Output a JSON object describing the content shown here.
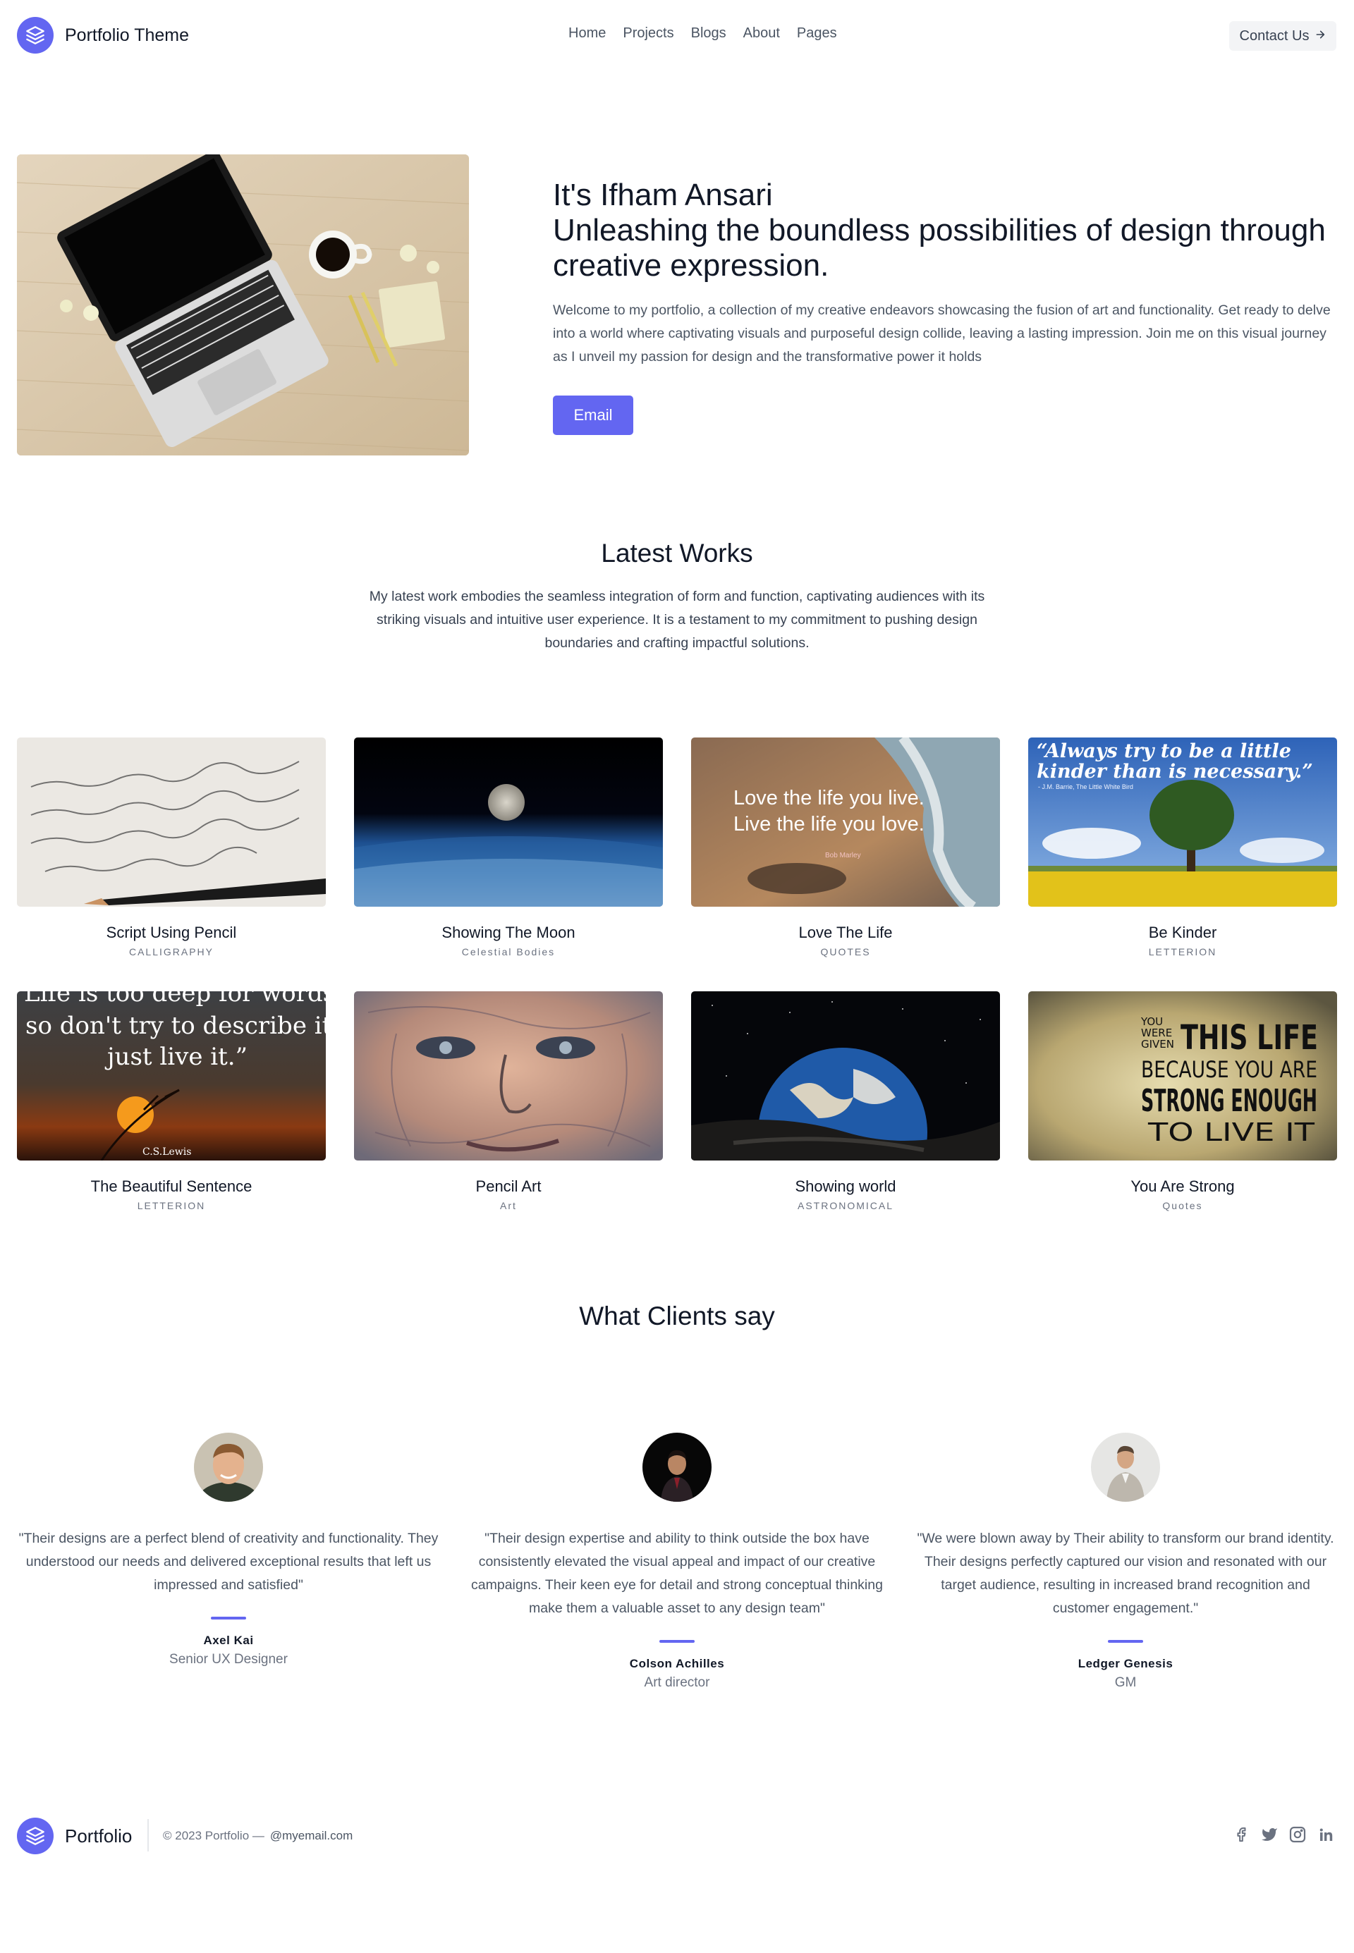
{
  "header": {
    "brand": "Portfolio Theme",
    "nav": [
      "Home",
      "Projects",
      "Blogs",
      "About",
      "Pages"
    ],
    "contact_label": "Contact Us"
  },
  "hero": {
    "greeting": "It's Ifham Ansari",
    "headline": "Unleashing the boundless possibilities of design through creative expression.",
    "description": "Welcome to my portfolio, a collection of my creative endeavors showcasing the fusion of art and functionality. Get ready to delve into a world where captivating visuals and purposeful design collide, leaving a lasting impression. Join me on this visual journey as I unveil my passion for design and the transformative power it holds",
    "button": "Email"
  },
  "works": {
    "title": "Latest Works",
    "description": "My latest work embodies the seamless integration of form and function, captivating audiences with its striking visuals and intuitive user experience. It is a testament to my commitment to pushing design boundaries and crafting impactful solutions.",
    "items": [
      {
        "title": "Script Using Pencil",
        "category": "CALLIGRAPHY"
      },
      {
        "title": "Showing The Moon",
        "category": "Celestial Bodies"
      },
      {
        "title": "Love The Life",
        "category": "QUOTES",
        "image_text": [
          "Love the life you live.",
          "Live the life you love.",
          "Bob Marley"
        ]
      },
      {
        "title": "Be Kinder",
        "category": "LETTERION",
        "image_text": [
          "“Always try to be a little",
          "kinder than is necessary.”",
          "- J.M. Barrie, The Little White Bird"
        ]
      },
      {
        "title": "The Beautiful Sentence",
        "category": "LETTERION",
        "image_text": [
          "Life is too deep for words,",
          "so don't try to describe it,",
          "just live it.”",
          "C.S.Lewis"
        ]
      },
      {
        "title": "Pencil Art",
        "category": "Art"
      },
      {
        "title": "Showing world",
        "category": "ASTRONOMICAL"
      },
      {
        "title": "You Are Strong",
        "category": "Quotes",
        "image_text": [
          "YOU",
          "WERE",
          "GIVEN",
          "THIS LIFE",
          "BECAUSE YOU ARE",
          "STRONG ENOUGH",
          "TO LIVE IT"
        ]
      }
    ]
  },
  "clients": {
    "title": "What Clients say",
    "items": [
      {
        "quote": "\"Their designs are a perfect blend of creativity and functionality. They understood our needs and delivered exceptional results that left us impressed and satisfied\"",
        "name": "Axel Kai",
        "role": "Senior UX Designer"
      },
      {
        "quote": "\"Their design expertise and ability to think outside the box have consistently elevated the visual appeal and impact of our creative campaigns. Their keen eye for detail and strong conceptual thinking make them a valuable asset to any design team\"",
        "name": "Colson Achilles",
        "role": "Art director"
      },
      {
        "quote": "\"We were blown away by Their ability to transform our brand identity. Their designs perfectly captured our vision and resonated with our target audience, resulting in increased brand recognition and customer engagement.\"",
        "name": "Ledger Genesis",
        "role": "GM"
      }
    ]
  },
  "footer": {
    "brand": "Portfolio",
    "copyright": "© 2023 Portfolio —",
    "email": "@myemail.com",
    "socials": [
      "facebook-icon",
      "twitter-icon",
      "instagram-icon",
      "linkedin-icon"
    ]
  },
  "colors": {
    "accent": "#6366f1"
  }
}
